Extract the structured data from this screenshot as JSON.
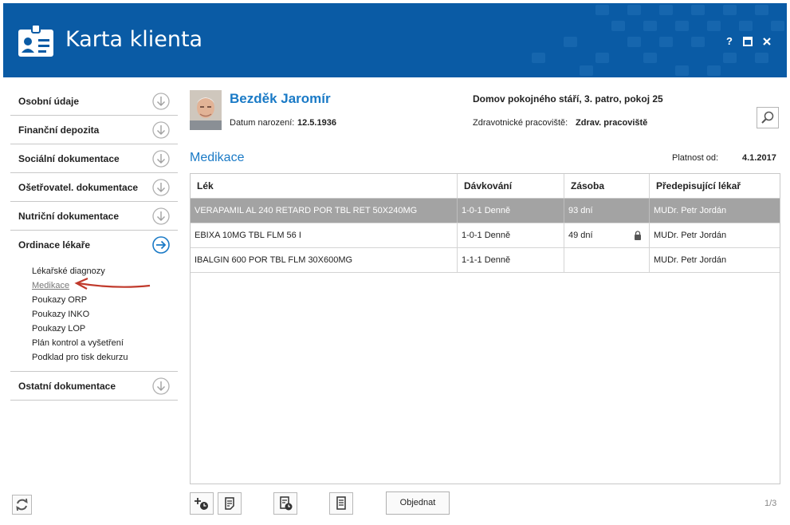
{
  "window": {
    "title": "Karta klienta",
    "help": "?"
  },
  "sidebar": {
    "items": [
      {
        "label": "Osobní údaje"
      },
      {
        "label": "Finanční depozita"
      },
      {
        "label": "Sociální dokumentace"
      },
      {
        "label": "Ošetřovatel. dokumentace"
      },
      {
        "label": "Nutriční dokumentace"
      },
      {
        "label": "Ordinace lékaře"
      },
      {
        "label": "Ostatní dokumentace"
      }
    ],
    "subitems": [
      {
        "label": "Lékařské diagnozy"
      },
      {
        "label": "Medikace"
      },
      {
        "label": "Poukazy ORP"
      },
      {
        "label": "Poukazy INKO"
      },
      {
        "label": "Poukazy LOP"
      },
      {
        "label": "Plán kontrol a vyšetření"
      },
      {
        "label": "Podklad pro tisk dekurzu"
      }
    ]
  },
  "patient": {
    "name": "Bezděk Jaromír",
    "dob_label": "Datum narození:",
    "dob": "12.5.1936",
    "address": "Domov pokojného stáří, 3. patro, pokoj 25",
    "workplace_label": "Zdravotnické pracoviště:",
    "workplace": "Zdrav. pracoviště"
  },
  "section": {
    "title": "Medikace",
    "valid_label": "Platnost od:",
    "valid_date": "4.1.2017"
  },
  "table": {
    "headers": [
      "Lék",
      "Dávkování",
      "Zásoba",
      "Předepisující lékař"
    ],
    "rows": [
      {
        "drug": "VERAPAMIL AL 240 RETARD POR TBL RET 50X240MG",
        "dose": "1-0-1 Denně",
        "stock": "93 dní",
        "doctor": "MUDr. Petr Jordán"
      },
      {
        "drug": "EBIXA 10MG TBL FLM 56 I",
        "dose": "1-0-1 Denně",
        "stock": "49 dní",
        "doctor": "MUDr. Petr Jordán"
      },
      {
        "drug": "IBALGIN 600 POR TBL FLM 30X600MG",
        "dose": "1-1-1 Denně",
        "stock": "",
        "doctor": "MUDr. Petr Jordán"
      }
    ]
  },
  "toolbar": {
    "order_label": "Objednat",
    "pager": "1/3"
  },
  "colors": {
    "header_bg": "#0a5ba5",
    "accent": "#1a7ac6",
    "selected_row": "#a3a3a3",
    "annotation_arrow": "#c0392b"
  }
}
